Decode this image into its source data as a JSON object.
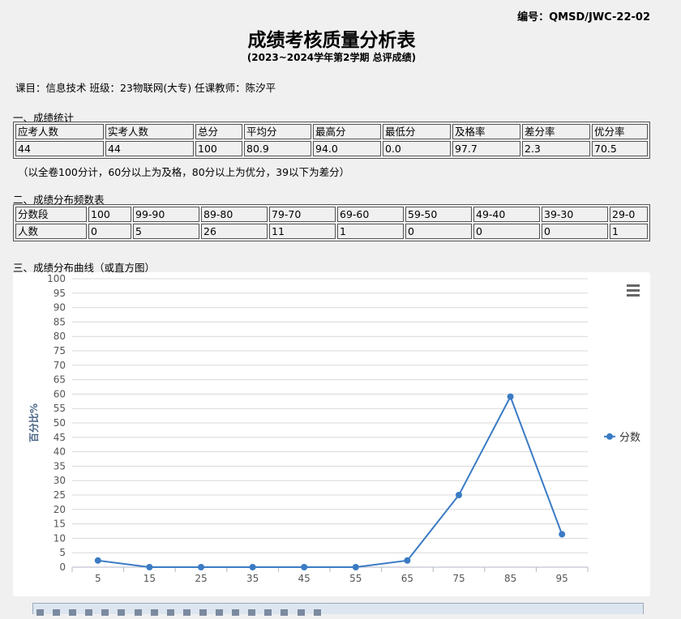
{
  "doc_code": "编号：QMSD/JWC-22-02",
  "title": "成绩考核质量分析表",
  "subtitle": "(2023~2024学年第2学期  总评成绩)",
  "course_line": "课目：信息技术 班级：23物联网(大专) 任课教师：陈汐平",
  "section1": {
    "heading": "一、成绩统计",
    "headers": [
      "应考人数",
      "实考人数",
      "总分",
      "平均分",
      "最高分",
      "最低分",
      "及格率",
      "差分率",
      "优分率"
    ],
    "values": [
      "44",
      "44",
      "100",
      "80.9",
      "94.0",
      "0.0",
      "97.7",
      "2.3",
      "70.5"
    ],
    "note": "（以全卷100分计，60分以上为及格，80分以上为优分，39以下为差分）"
  },
  "section2": {
    "heading": "二、成绩分布频数表",
    "row1": [
      "分数段",
      "100",
      "99-90",
      "89-80",
      "79-70",
      "69-60",
      "59-50",
      "49-40",
      "39-30",
      "29-0"
    ],
    "row2": [
      "人数",
      "0",
      "5",
      "26",
      "11",
      "1",
      "0",
      "0",
      "0",
      "1"
    ]
  },
  "section3": {
    "heading": "三、成绩分布曲线（或直方图）"
  },
  "chart_data": {
    "type": "line",
    "x": [
      5,
      15,
      25,
      35,
      45,
      55,
      65,
      75,
      85,
      95
    ],
    "series": [
      {
        "name": "分数",
        "values": [
          2.3,
          0,
          0,
          0,
          0,
          0,
          2.3,
          25,
          59.1,
          11.4
        ]
      }
    ],
    "ylabel": "百分比%",
    "ylim": [
      0,
      100
    ],
    "yticks": [
      0,
      5,
      10,
      15,
      20,
      25,
      30,
      35,
      40,
      45,
      50,
      55,
      60,
      65,
      70,
      75,
      80,
      85,
      90,
      95,
      100
    ],
    "xticks": [
      5,
      15,
      25,
      35,
      45,
      55,
      65,
      75,
      85,
      95
    ],
    "grid": true,
    "legend": "right",
    "line_color": "#3a7bc4"
  }
}
